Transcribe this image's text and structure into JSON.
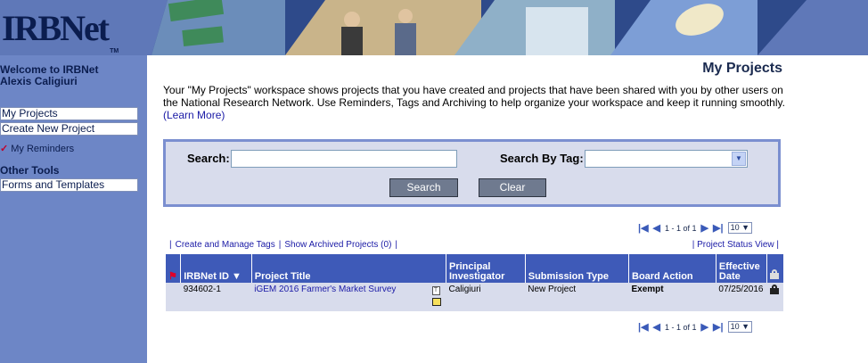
{
  "header": {
    "logo": "IRBNet",
    "logo_tm": "TM"
  },
  "sidebar": {
    "welcome_line1": "Welcome to IRBNet",
    "welcome_line2": "Alexis Caligiuri",
    "items": [
      {
        "label": "My Projects"
      },
      {
        "label": "Create New Project"
      }
    ],
    "reminders_label": "My Reminders",
    "other_tools_heading": "Other Tools",
    "forms_label": "Forms and Templates"
  },
  "main": {
    "title": "My Projects",
    "intro_text": "Your \"My Projects\" workspace shows projects that you have created and projects that have been shared with you by other users on the National Research Network. Use Reminders, Tags and Archiving to help organize your workspace and keep it running smoothly. ",
    "learn_more": "(Learn More)"
  },
  "search": {
    "search_label": "Search:",
    "search_value": "",
    "tag_label": "Search By Tag:",
    "tag_value": "",
    "search_button": "Search",
    "clear_button": "Clear"
  },
  "pager": {
    "range": "1 - 1 of 1",
    "per_page": "10"
  },
  "links": {
    "create_tags": "Create and Manage Tags",
    "archived": "Show Archived Projects (0)",
    "status_view": "Project Status View"
  },
  "table": {
    "headers": {
      "id": "IRBNet ID",
      "title": "Project Title",
      "pi": "Principal Investigator",
      "type": "Submission Type",
      "action": "Board Action",
      "date": "Effective Date"
    },
    "rows": [
      {
        "id": "934602-1",
        "title": "iGEM 2016 Farmer's Market Survey",
        "pi": "Caligiuri",
        "type": "New Project",
        "action": "Exempt",
        "date": "07/25/2016"
      }
    ]
  },
  "colors": {
    "header": "#5f78b8",
    "sidebar": "#6d86c6",
    "table_header": "#3e5ab8",
    "row": "#d8dcec",
    "exempt": "#2a8a2a"
  },
  "icons": [
    "flag-icon",
    "lock-icon",
    "first-page-icon",
    "prev-page-icon",
    "next-page-icon",
    "last-page-icon",
    "note-icon",
    "sort-down-icon"
  ]
}
